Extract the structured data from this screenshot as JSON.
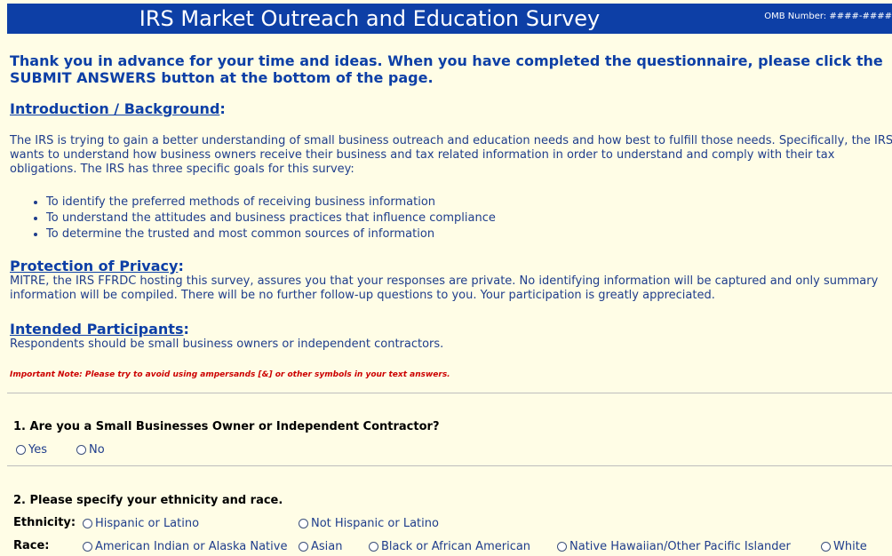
{
  "header": {
    "title": "IRS Market Outreach and Education Survey",
    "omb": "OMB Number: ####-####"
  },
  "intro": "Thank you in advance for your time and ideas. When you have completed the questionnaire, please click the SUBMIT ANSWERS button at the bottom of the page.",
  "background": {
    "heading": "Introduction / Background",
    "colon": ":",
    "text": "The IRS is trying to gain a better understanding of small business outreach and education needs and how best to fulfill those needs. Specifically, the IRS wants to understand how business owners receive their business and tax related information in order to understand and comply with their tax obligations. The IRS has three specific goals for this survey:",
    "goals": [
      "To identify the preferred methods of receiving business information",
      "To understand the attitudes and business practices that influence compliance",
      "To determine the trusted and most common sources of information"
    ]
  },
  "privacy": {
    "heading": "Protection of Privacy",
    "colon": ":",
    "text": "MITRE, the IRS FFRDC hosting this survey, assures you that your responses are private. No identifying information will be captured and only summary information will be compiled. There will be no further follow-up questions to you. Your participation is greatly appreciated."
  },
  "participants": {
    "heading": "Intended Participants",
    "colon": ":",
    "text": "Respondents should be small business owners or independent contractors."
  },
  "note": "Important Note: Please try to avoid using ampersands [&] or other symbols in your text answers.",
  "q1": {
    "question": "1. Are you a Small Businesses Owner or Independent Contractor?",
    "options": [
      "Yes",
      "No"
    ]
  },
  "q2": {
    "question": "2. Please specify your ethnicity and race.",
    "ethnicity_label": "Ethnicity:",
    "ethnicity_options": [
      "Hispanic or Latino",
      "Not Hispanic or Latino"
    ],
    "race_label": "Race:",
    "race_options": [
      "American Indian or Alaska Native",
      "Asian",
      "Black or African American",
      "Native Hawaiian/Other Pacific Islander",
      "White"
    ]
  }
}
